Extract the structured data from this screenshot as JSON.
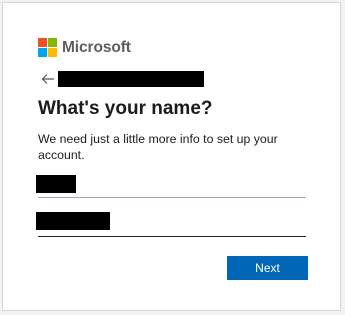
{
  "brand": {
    "name": "Microsoft",
    "logo_colors": [
      "#f25022",
      "#7fba00",
      "#00a4ef",
      "#ffb900"
    ]
  },
  "back": {
    "icon": "back-arrow-icon",
    "email": "[redacted]"
  },
  "page": {
    "title": "What's your name?",
    "description": "We need just a little more info to set up your account."
  },
  "form": {
    "first_name": "[redacted]",
    "last_name": "[redacted]"
  },
  "actions": {
    "next_label": "Next",
    "accent_color": "#0067b8"
  }
}
